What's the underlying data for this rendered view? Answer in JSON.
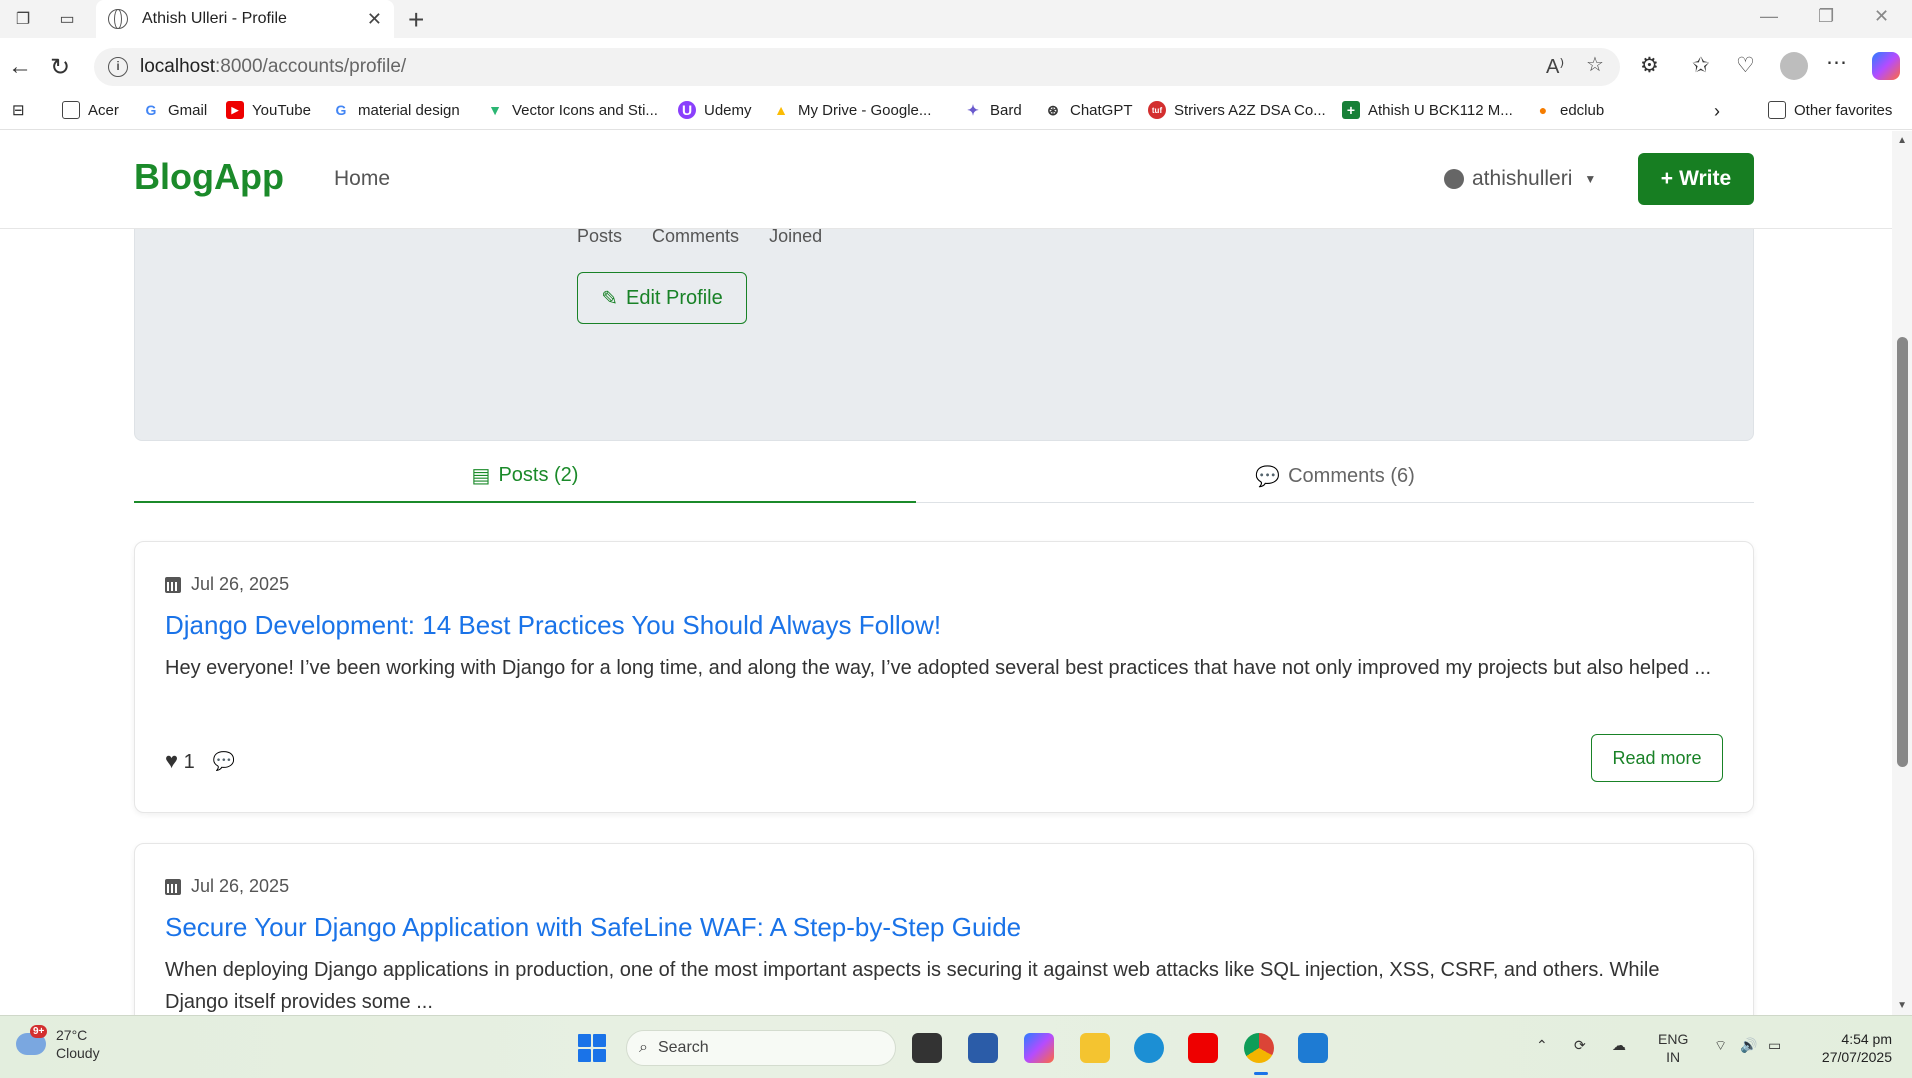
{
  "browser": {
    "tab_title": "Athish Ulleri - Profile",
    "url_host": "localhost",
    "url_rest": ":8000/accounts/profile/",
    "bookmarks": [
      "Acer",
      "Gmail",
      "YouTube",
      "material design",
      "Vector Icons and Sti...",
      "Udemy",
      "My Drive - Google...",
      "Bard",
      "ChatGPT",
      "Strivers A2Z DSA Co...",
      "Athish U BCK112 M...",
      "edclub"
    ],
    "other_favorites": "Other favorites"
  },
  "app": {
    "brand": "BlogApp",
    "nav_home": "Home",
    "username": "athishulleri",
    "write_label": "Write",
    "accent": "#1b8a2a"
  },
  "profile": {
    "stat_posts": "Posts",
    "stat_comments": "Comments",
    "stat_joined": "Joined",
    "edit_label": "Edit Profile"
  },
  "tabs": {
    "posts": "Posts (2)",
    "comments": "Comments (6)"
  },
  "posts": [
    {
      "date": "Jul 26, 2025",
      "title": "Django Development: 14 Best Practices You Should Always Follow!",
      "excerpt": "Hey everyone! I’ve been working with Django for a long time, and along the way, I’ve adopted several best practices that have not only improved my projects but also helped ...",
      "likes": "1",
      "read_more": "Read more"
    },
    {
      "date": "Jul 26, 2025",
      "title": "Secure Your Django Application with SafeLine WAF: A Step-by-Step Guide",
      "excerpt": "When deploying Django applications in production, one of the most important aspects is securing it against web attacks like SQL injection, XSS, CSRF, and others. While Django itself provides some ..."
    }
  ],
  "taskbar": {
    "weather_badge": "9+",
    "temp": "27°C",
    "condition": "Cloudy",
    "search": "Search",
    "lang": "ENG",
    "region": "IN",
    "time": "4:54 pm",
    "date": "27/07/2025"
  }
}
